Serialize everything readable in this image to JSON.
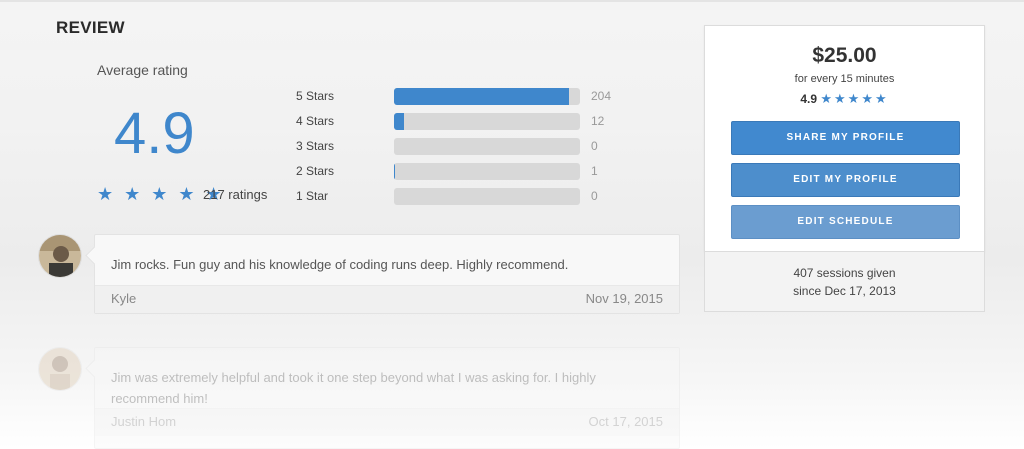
{
  "section": {
    "title": "REVIEW"
  },
  "average": {
    "label": "Average rating",
    "value": "4.9",
    "stars": "★ ★ ★ ★ ★",
    "count": "217 ratings"
  },
  "breakdown": [
    {
      "label": "5 Stars",
      "count": "204",
      "fraction": 0.94
    },
    {
      "label": "4 Stars",
      "count": "12",
      "fraction": 0.055
    },
    {
      "label": "3 Stars",
      "count": "0",
      "fraction": 0
    },
    {
      "label": "2 Stars",
      "count": "1",
      "fraction": 0.006
    },
    {
      "label": "1 Star",
      "count": "0",
      "fraction": 0
    }
  ],
  "reviews": [
    {
      "text": "Jim rocks. Fun guy and his knowledge of coding runs deep. Highly recommend.",
      "author": "Kyle",
      "date": "Nov 19, 2015"
    },
    {
      "text": "Jim was extremely helpful and took it one step beyond what I was asking for. I highly recommend him!",
      "author": "Justin Hom",
      "date": "Oct 17, 2015"
    }
  ],
  "sidebar": {
    "price": "$25.00",
    "rate": "for every 15 minutes",
    "rating": "4.9",
    "stars": "★★★★★",
    "buttons": {
      "share": "SHARE MY PROFILE",
      "edit": "EDIT MY PROFILE",
      "schedule": "EDIT SCHEDULE"
    },
    "sessions": "407 sessions given",
    "since": "since Dec 17, 2013"
  },
  "colors": {
    "accent": "#3f87cc",
    "track": "#d8d8d8"
  }
}
